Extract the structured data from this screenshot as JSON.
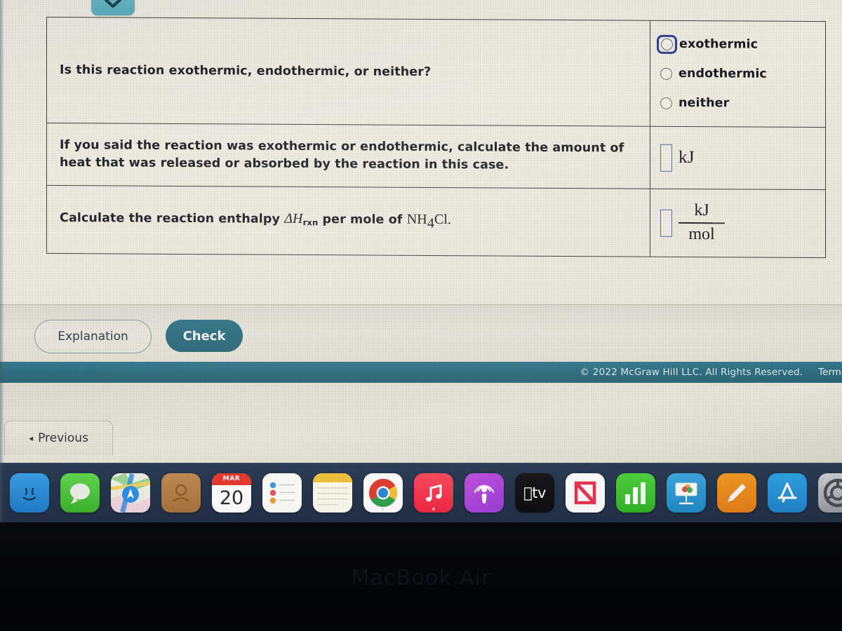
{
  "top_control": {
    "icon": "chevron-down-icon"
  },
  "question_table": {
    "rows": [
      {
        "prompt": "Is this reaction exothermic, endothermic, or neither?",
        "answer_type": "radio",
        "options": [
          {
            "label": "exothermic",
            "selected": false,
            "focused": true
          },
          {
            "label": "endothermic",
            "selected": false,
            "focused": false
          },
          {
            "label": "neither",
            "selected": false,
            "focused": false
          }
        ]
      },
      {
        "prompt": "If you said the reaction was exothermic or endothermic, calculate the amount of heat that was released or absorbed by the reaction in this case.",
        "answer_type": "input-with-unit",
        "input_value": "",
        "unit": "kJ"
      },
      {
        "prompt_prefix": "Calculate the reaction enthalpy ",
        "prompt_symbol": "ΔH",
        "prompt_symbol_sub": "rxn",
        "prompt_middle": " per mole of ",
        "prompt_formula": "NH",
        "prompt_formula_sub": "4",
        "prompt_formula_tail": "Cl.",
        "answer_type": "input-with-fraction-unit",
        "input_value": "",
        "unit_numerator": "kJ",
        "unit_denominator": "mol"
      }
    ]
  },
  "actions": {
    "explanation_label": "Explanation",
    "check_label": "Check"
  },
  "footer": {
    "copyright": "© 2022 McGraw Hill LLC. All Rights Reserved.",
    "terms_label": "Terms"
  },
  "navigation": {
    "previous_label": "Previous",
    "previous_arrow": "◂"
  },
  "dock": {
    "items": [
      {
        "name": "finder",
        "icon": "finder-icon",
        "running": false
      },
      {
        "name": "messages",
        "icon": "messages-icon",
        "running": false
      },
      {
        "name": "maps",
        "icon": "maps-icon",
        "running": false
      },
      {
        "name": "contacts",
        "icon": "contacts-icon",
        "running": false
      },
      {
        "name": "calendar",
        "icon": "calendar-icon",
        "running": false,
        "month": "MAR",
        "day": "20"
      },
      {
        "name": "reminders",
        "icon": "reminders-icon",
        "running": false
      },
      {
        "name": "notes",
        "icon": "notes-icon",
        "running": false
      },
      {
        "name": "chrome",
        "icon": "chrome-icon",
        "running": true
      },
      {
        "name": "music",
        "icon": "music-icon",
        "running": true
      },
      {
        "name": "podcasts",
        "icon": "podcasts-icon",
        "running": false
      },
      {
        "name": "appletv",
        "icon": "apple-tv-icon",
        "running": false,
        "label": "tv"
      },
      {
        "name": "news",
        "icon": "news-icon",
        "running": false
      },
      {
        "name": "numbers",
        "icon": "numbers-icon",
        "running": false
      },
      {
        "name": "keynote",
        "icon": "keynote-icon",
        "running": false
      },
      {
        "name": "pages",
        "icon": "pages-icon",
        "running": false
      },
      {
        "name": "appstore",
        "icon": "app-store-icon",
        "running": false
      },
      {
        "name": "sysprefs",
        "icon": "system-preferences-icon",
        "running": false
      }
    ]
  },
  "device": {
    "model_name": "MacBook Air"
  },
  "colors": {
    "accent_teal": "#2f7386",
    "footer_teal": "#2c6c7e",
    "focus_blue": "#2a3c86",
    "input_border_blue": "#5166a8",
    "dock_bg": "#26354c",
    "table_border": "#3c3b3c"
  }
}
